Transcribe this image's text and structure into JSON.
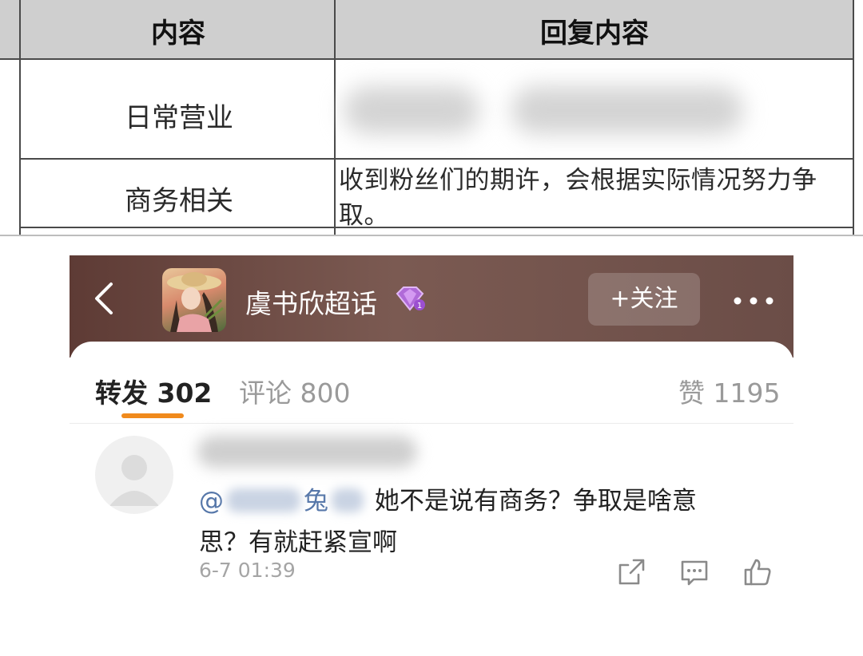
{
  "document_table": {
    "headers": [
      "内容",
      "回复内容"
    ],
    "rows": [
      {
        "topic": "日常营业",
        "reply": ""
      },
      {
        "topic": "商务相关",
        "reply": "收到粉丝们的期许，会根据实际情况努力争取。"
      }
    ]
  },
  "topbar": {
    "title": "虞书欣超话",
    "level_badge": "1",
    "follow_label": "+关注",
    "icons": [
      "back-icon",
      "diamond-icon",
      "more-icon"
    ],
    "background": "#6b4d47"
  },
  "tabs": {
    "repost": "转发 302",
    "comment": "评论 800",
    "like": "赞 1195",
    "active_color": "#f08a1c"
  },
  "comment": {
    "mention_prefix": "@",
    "mention_visible": "兔",
    "text_line1": "她不是说有商务？争取是啥意",
    "text_line2": "思？有就赶紧宣啊",
    "timestamp": "6-7 01:39",
    "icons": [
      "share-icon",
      "comment-icon",
      "like-icon"
    ]
  }
}
